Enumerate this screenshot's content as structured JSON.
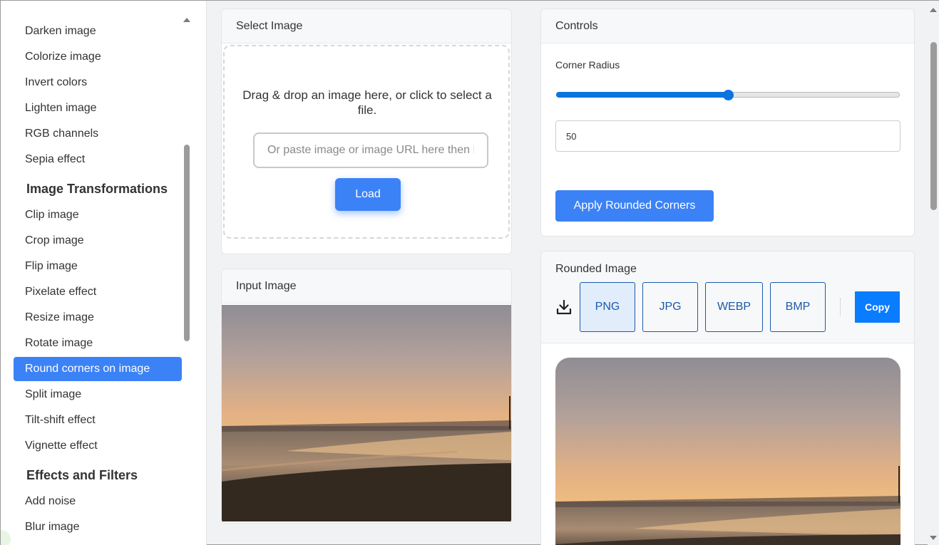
{
  "sidebar": {
    "items": [
      {
        "type": "item",
        "label": "Darken image"
      },
      {
        "type": "item",
        "label": "Colorize image"
      },
      {
        "type": "item",
        "label": "Invert colors"
      },
      {
        "type": "item",
        "label": "Lighten image"
      },
      {
        "type": "item",
        "label": "RGB channels"
      },
      {
        "type": "item",
        "label": "Sepia effect"
      },
      {
        "type": "header",
        "label": "Image Transformations"
      },
      {
        "type": "item",
        "label": "Clip image"
      },
      {
        "type": "item",
        "label": "Crop image"
      },
      {
        "type": "item",
        "label": "Flip image"
      },
      {
        "type": "item",
        "label": "Pixelate effect"
      },
      {
        "type": "item",
        "label": "Resize image"
      },
      {
        "type": "item",
        "label": "Rotate image"
      },
      {
        "type": "item",
        "label": "Round corners on image",
        "active": true
      },
      {
        "type": "item",
        "label": "Split image"
      },
      {
        "type": "item",
        "label": "Tilt-shift effect"
      },
      {
        "type": "item",
        "label": "Vignette effect"
      },
      {
        "type": "header",
        "label": "Effects and Filters"
      },
      {
        "type": "item",
        "label": "Add noise"
      },
      {
        "type": "item",
        "label": "Blur image"
      }
    ]
  },
  "select_card": {
    "title": "Select Image",
    "drop_text": "Drag & drop an image here, or click to select a file.",
    "url_placeholder": "Or paste image or image URL here then L",
    "load_label": "Load"
  },
  "input_card": {
    "title": "Input Image"
  },
  "controls_card": {
    "title": "Controls",
    "radius_label": "Corner Radius",
    "radius_fraction": 0.5,
    "radius_value": "50",
    "apply_label": "Apply Rounded Corners"
  },
  "rounded_card": {
    "title": "Rounded Image",
    "formats": [
      "PNG",
      "JPG",
      "WEBP",
      "BMP"
    ],
    "selected_format": "PNG",
    "copy_label": "Copy"
  },
  "colors": {
    "accent": "#3b82f6",
    "slider": "#0b74de",
    "format_border": "#1a5aab",
    "copy_button": "#0a7cff"
  },
  "icons": {
    "download": "download-icon",
    "scroll_up": "chevron-up-icon",
    "scroll_down": "chevron-down-icon"
  }
}
